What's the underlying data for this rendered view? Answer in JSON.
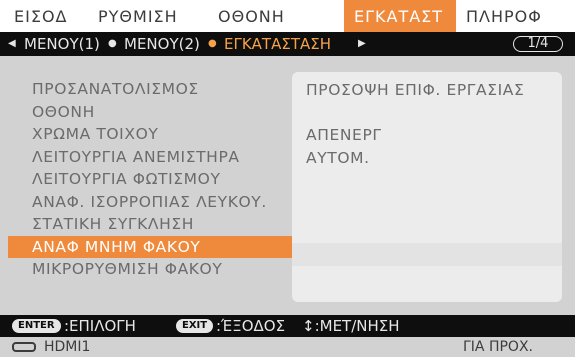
{
  "tabs": [
    {
      "label": "ΕΙΣΟΔ"
    },
    {
      "label": "ΡΥΘΜΙΣΗ"
    },
    {
      "label": "ΟΘΟΝΗ"
    },
    {
      "label": "ΕΓΚΑΤΑΣΤ"
    },
    {
      "label": "ΠΛΗΡΟΦ"
    }
  ],
  "active_tab": "ΕΓΚΑΤΑΣΤ",
  "submenu": {
    "items": [
      {
        "label": "ΜΕΝΟΥ(1)"
      },
      {
        "label": "ΜΕΝΟΥ(2)"
      },
      {
        "label": "ΕΓΚΑΤΑΣΤΑΣΗ"
      }
    ],
    "page": "1/4"
  },
  "settings": [
    {
      "label": "ΠΡΟΣΑΝΑΤΟΛΙΣΜΟΣ",
      "value": "ΠΡΟΣΟΨΗ ΕΠΙΦ. ΕΡΓΑΣΙΑΣ"
    },
    {
      "label": "ΟΘΟΝΗ",
      "value": ""
    },
    {
      "label": "ΧΡΩΜΑ ΤΟΙΧΟΥ",
      "value": "ΑΠΕΝΕΡΓ"
    },
    {
      "label": "ΛΕΙΤΟΥΡΓΙΑ ΑΝΕΜΙΣΤΗΡΑ",
      "value": "ΑΥΤΟΜ."
    },
    {
      "label": "ΛΕΙΤΟΥΡΓΙΑ  ΦΩΤΙΣΜΟΥ",
      "value": ""
    },
    {
      "label": "ΑΝΑΦ. ΙΣΟΡΡΟΠΙΑΣ ΛΕΥΚΟΥ.",
      "value": ""
    },
    {
      "label": "ΣΤΑΤΙΚΗ ΣΥΓΚΛΗΣΗ",
      "value": ""
    },
    {
      "label": "ΑΝΑΦ ΜΝΗΜ ΦΑΚΟΥ",
      "value": ""
    },
    {
      "label": "ΜΙΚΡΟΡΥΘΜΙΣΗ ΦΑΚΟΥ",
      "value": ""
    }
  ],
  "selected_setting": "ΑΝΑΦ ΜΝΗΜ ΦΑΚΟΥ",
  "hints": {
    "enter_key": "ENTER",
    "enter_label": ":ΕΠΙΛΟΓΗ",
    "exit_key": "EXIT",
    "exit_label": ":ΈΞΟΔΟΣ",
    "move_label": "↕:ΜΕΤ/ΝΗΣΗ"
  },
  "status": {
    "input_icon": "hdmi-input-icon",
    "input_name": "HDMI1",
    "right_text": "ΓΙΑ ΠΡΟΧ."
  },
  "colors": {
    "accent": "#ef8a3c",
    "bar": "#0e0e0e",
    "panel": "#d2d2d2"
  }
}
